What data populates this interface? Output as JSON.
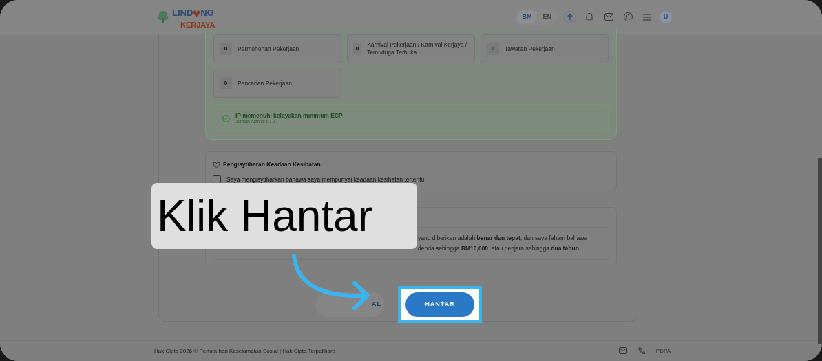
{
  "header": {
    "logo": {
      "top_left": "LIND",
      "top_right": "NG",
      "bottom": "KERJAYA"
    },
    "languages": [
      {
        "label": "BM",
        "selected": true
      },
      {
        "label": "EN",
        "selected": false
      }
    ],
    "avatar": "U"
  },
  "stats": [
    {
      "count": "0",
      "label": "Permohonan Pekerjaan"
    },
    {
      "count": "0",
      "label": "Karnival Pekerjaan / Karnival Kerjaya / Temuduga Terbuka"
    },
    {
      "count": "0",
      "label": "Tawaran Pekerjaan"
    },
    {
      "count": "0",
      "label": "Pencarian Pekerjaan"
    }
  ],
  "eligibility": {
    "title": "IP memenuhi kelayakan minimum ECP",
    "subtitle": "Jumlah Aktiviti: 0 / 0"
  },
  "health": {
    "title": "Pengisytiharan Keadaan Kesihatan",
    "checkbox": {
      "label": "Saya mengisytiharkan bahawa saya mempunyai keadaan kesihatan tertentu",
      "checked": false
    }
  },
  "declaration": {
    "lines": [
      "yang diberikan adalah **benar dan tepat**, dan saya faham bahawa",
      "denda sehingga **RM10,000**, atau penjara sehingga **dua tahun**."
    ]
  },
  "buttons": [
    {
      "label": "AL",
      "kind": "secondary",
      "highlighted": false
    },
    {
      "label": "HANTAR",
      "kind": "primary",
      "highlighted": true
    }
  ],
  "callout": {
    "text": "Klik Hantar"
  },
  "footer": {
    "copyright": "Hak Cipta 2026 © Pertubuhan Keselamatan Sosial | Hak Cipta Terpelihara",
    "link": "PDPA"
  }
}
